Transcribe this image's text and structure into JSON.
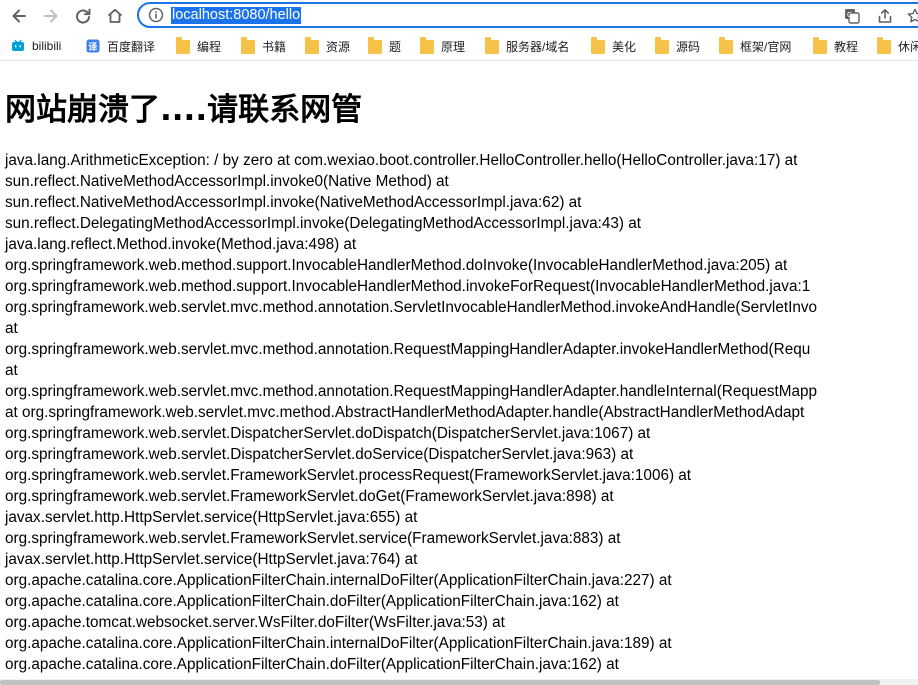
{
  "browser": {
    "url": "localhost:8080/hello"
  },
  "bookmarks": [
    {
      "label": "bilibili",
      "icon": "bilibili-icon"
    },
    {
      "label": "百度翻译",
      "icon": "baidu-translate-icon"
    },
    {
      "label": "编程",
      "icon": "folder-icon"
    },
    {
      "label": "书籍",
      "icon": "folder-icon"
    },
    {
      "label": "资源",
      "icon": "folder-icon"
    },
    {
      "label": "题",
      "icon": "folder-icon"
    },
    {
      "label": "原理",
      "icon": "folder-icon"
    },
    {
      "label": "服务器/域名",
      "icon": "folder-icon"
    },
    {
      "label": "美化",
      "icon": "folder-icon"
    },
    {
      "label": "源码",
      "icon": "folder-icon"
    },
    {
      "label": "框架/官网",
      "icon": "folder-icon"
    },
    {
      "label": "教程",
      "icon": "folder-icon"
    },
    {
      "label": "休闲",
      "icon": "folder-icon"
    }
  ],
  "page": {
    "title": "网站崩溃了....请联系网管",
    "trace_lines": [
      "java.lang.ArithmeticException: / by zero at com.wexiao.boot.controller.HelloController.hello(HelloController.java:17) at",
      "sun.reflect.NativeMethodAccessorImpl.invoke0(Native Method) at",
      "sun.reflect.NativeMethodAccessorImpl.invoke(NativeMethodAccessorImpl.java:62) at",
      "sun.reflect.DelegatingMethodAccessorImpl.invoke(DelegatingMethodAccessorImpl.java:43) at",
      "java.lang.reflect.Method.invoke(Method.java:498) at",
      "org.springframework.web.method.support.InvocableHandlerMethod.doInvoke(InvocableHandlerMethod.java:205) at",
      "org.springframework.web.method.support.InvocableHandlerMethod.invokeForRequest(InvocableHandlerMethod.java:1",
      "org.springframework.web.servlet.mvc.method.annotation.ServletInvocableHandlerMethod.invokeAndHandle(ServletInvo",
      "at",
      "org.springframework.web.servlet.mvc.method.annotation.RequestMappingHandlerAdapter.invokeHandlerMethod(Requ",
      "at",
      "org.springframework.web.servlet.mvc.method.annotation.RequestMappingHandlerAdapter.handleInternal(RequestMapp",
      "at org.springframework.web.servlet.mvc.method.AbstractHandlerMethodAdapter.handle(AbstractHandlerMethodAdapt",
      "org.springframework.web.servlet.DispatcherServlet.doDispatch(DispatcherServlet.java:1067) at",
      "org.springframework.web.servlet.DispatcherServlet.doService(DispatcherServlet.java:963) at",
      "org.springframework.web.servlet.FrameworkServlet.processRequest(FrameworkServlet.java:1006) at",
      "org.springframework.web.servlet.FrameworkServlet.doGet(FrameworkServlet.java:898) at",
      "javax.servlet.http.HttpServlet.service(HttpServlet.java:655) at",
      "org.springframework.web.servlet.FrameworkServlet.service(FrameworkServlet.java:883) at",
      "javax.servlet.http.HttpServlet.service(HttpServlet.java:764) at",
      "org.apache.catalina.core.ApplicationFilterChain.internalDoFilter(ApplicationFilterChain.java:227) at",
      "org.apache.catalina.core.ApplicationFilterChain.doFilter(ApplicationFilterChain.java:162) at",
      "org.apache.tomcat.websocket.server.WsFilter.doFilter(WsFilter.java:53) at",
      "org.apache.catalina.core.ApplicationFilterChain.internalDoFilter(ApplicationFilterChain.java:189) at",
      "org.apache.catalina.core.ApplicationFilterChain.doFilter(ApplicationFilterChain.java:162) at"
    ]
  },
  "colors": {
    "accent": "#1a73e8",
    "folder": "#f6c247",
    "bilibili": "#00a1d6"
  }
}
